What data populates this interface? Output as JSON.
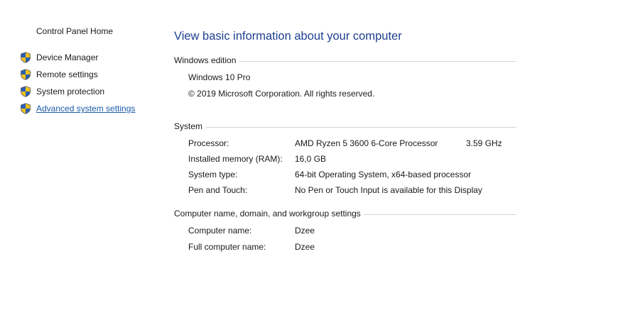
{
  "sidebar": {
    "home_label": "Control Panel Home",
    "items": [
      {
        "label": "Device Manager",
        "icon": "uac-shield-icon"
      },
      {
        "label": "Remote settings",
        "icon": "uac-shield-icon"
      },
      {
        "label": "System protection",
        "icon": "uac-shield-icon"
      },
      {
        "label": "Advanced system settings",
        "icon": "uac-shield-icon",
        "is_link": true
      }
    ]
  },
  "main": {
    "title": "View basic information about your computer",
    "windows_edition": {
      "header": "Windows edition",
      "edition": "Windows 10 Pro",
      "copyright": "© 2019 Microsoft Corporation. All rights reserved."
    },
    "system": {
      "header": "System",
      "rows": [
        {
          "key": "Processor:",
          "value": "AMD Ryzen 5 3600 6-Core Processor",
          "extra": "3.59 GHz"
        },
        {
          "key": "Installed memory (RAM):",
          "value": "16,0 GB"
        },
        {
          "key": "System type:",
          "value": "64-bit Operating System, x64-based processor"
        },
        {
          "key": "Pen and Touch:",
          "value": "No Pen or Touch Input is available for this Display"
        }
      ]
    },
    "computer_name": {
      "header": "Computer name, domain, and workgroup settings",
      "rows": [
        {
          "key": "Computer name:",
          "value": "Dzee"
        },
        {
          "key": "Full computer name:",
          "value": "Dzee"
        }
      ]
    }
  },
  "colors": {
    "title": "#1e3f8f",
    "link": "#1c5aa8",
    "shield_blue": "#2b5fb4",
    "shield_yellow": "#f2c21a",
    "rule": "#d6d6d6"
  }
}
